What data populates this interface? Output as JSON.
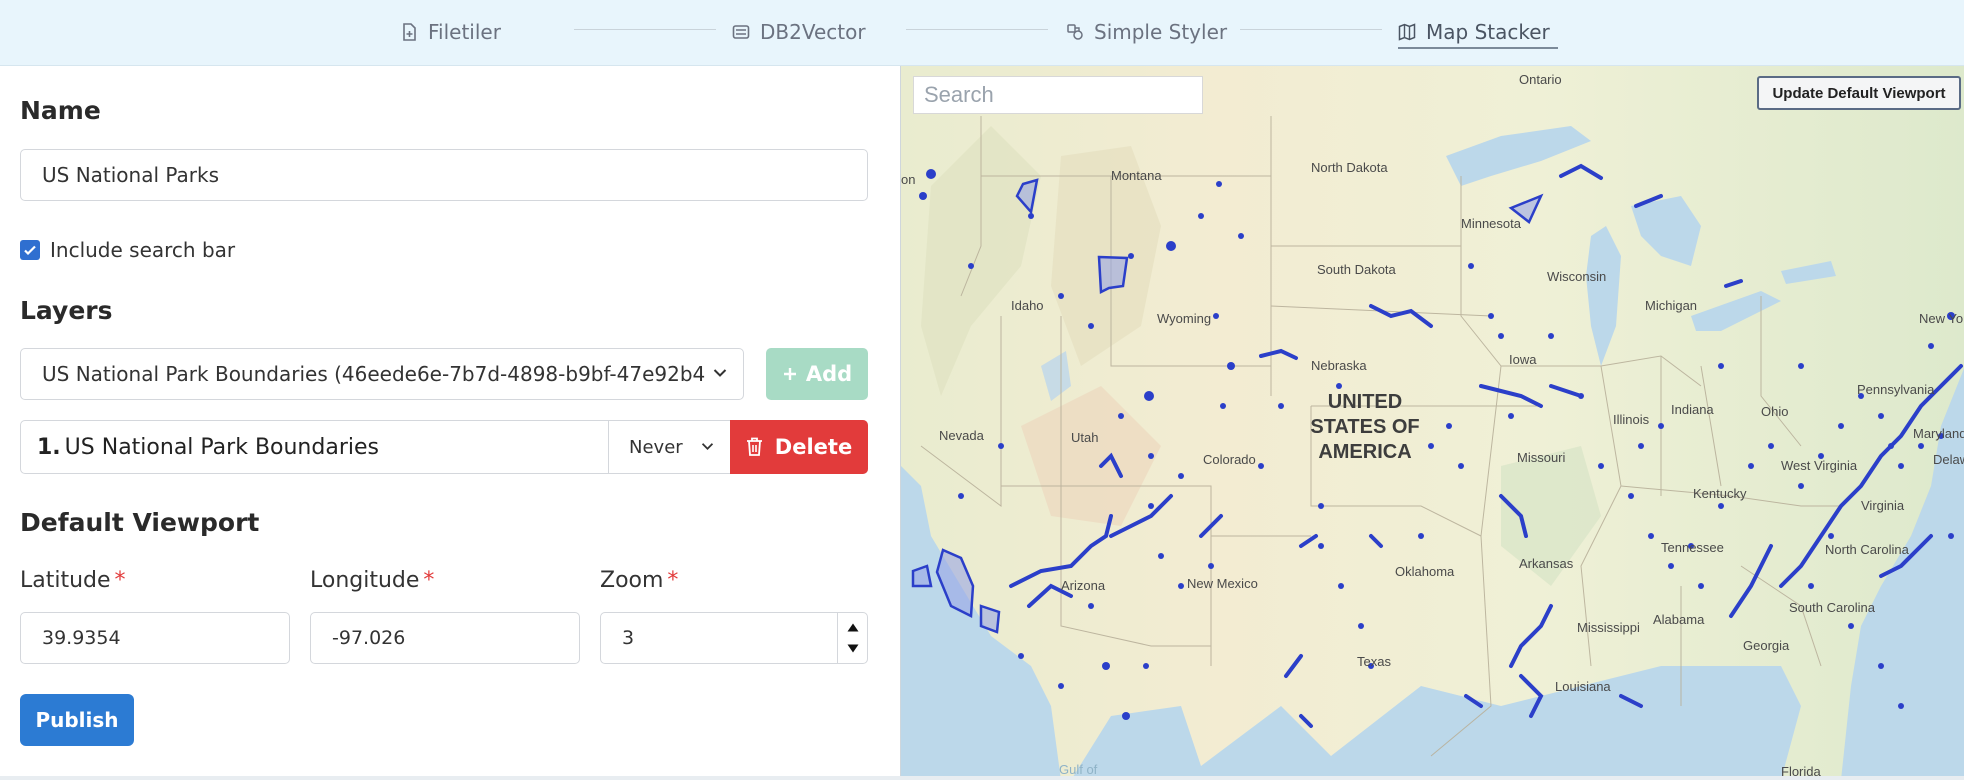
{
  "nav": {
    "items": [
      {
        "label": "Filetiler",
        "icon": "file-plus-icon"
      },
      {
        "label": "DB2Vector",
        "icon": "database-icon"
      },
      {
        "label": "Simple Styler",
        "icon": "palette-icon"
      },
      {
        "label": "Map Stacker",
        "icon": "map-icon"
      }
    ],
    "active": "Map Stacker"
  },
  "form": {
    "name_label": "Name",
    "name_value": "US National Parks",
    "include_search_label": "Include search bar",
    "include_search_checked": true,
    "layers_label": "Layers",
    "layer_select_value": "US National Park Boundaries (46eede6e-7b7d-4898-b9bf-47e92b4",
    "add_label": "Add",
    "layers": [
      {
        "index": "1.",
        "name": "US National Park Boundaries",
        "visibility": "Never",
        "delete_label": "Delete"
      }
    ],
    "viewport_label": "Default Viewport",
    "latitude_label": "Latitude",
    "latitude_value": "39.9354",
    "longitude_label": "Longitude",
    "longitude_value": "-97.026",
    "zoom_label": "Zoom",
    "zoom_value": "3",
    "required_mark": "*",
    "publish_label": "Publish"
  },
  "map": {
    "search_placeholder": "Search",
    "update_viewport_label": "Update Default Viewport",
    "country_label": "UNITED STATES OF AMERICA",
    "labels": [
      "Ontario",
      "North Dakota",
      "Montana",
      "Minnesota",
      "South Dakota",
      "Wisconsin",
      "Michigan",
      "New York",
      "Idaho",
      "Wyoming",
      "Nebraska",
      "Iowa",
      "Pennsylvania",
      "Nevada",
      "Utah",
      "Illinois",
      "Indiana",
      "Ohio",
      "Colorado",
      "Missouri",
      "West Virginia",
      "Kentucky",
      "Virginia",
      "Delaware",
      "Maryland",
      "Tennessee",
      "North Carolina",
      "Arizona",
      "New Mexico",
      "Oklahoma",
      "Arkansas",
      "Alabama",
      "Mississippi",
      "Georgia",
      "South Carolina",
      "Texas",
      "Louisiana",
      "Florida",
      "on",
      "Gulf of"
    ],
    "colors": {
      "land": "#f1ecd0",
      "water": "#bcd8ea",
      "parks": "#2b3fc9"
    }
  }
}
